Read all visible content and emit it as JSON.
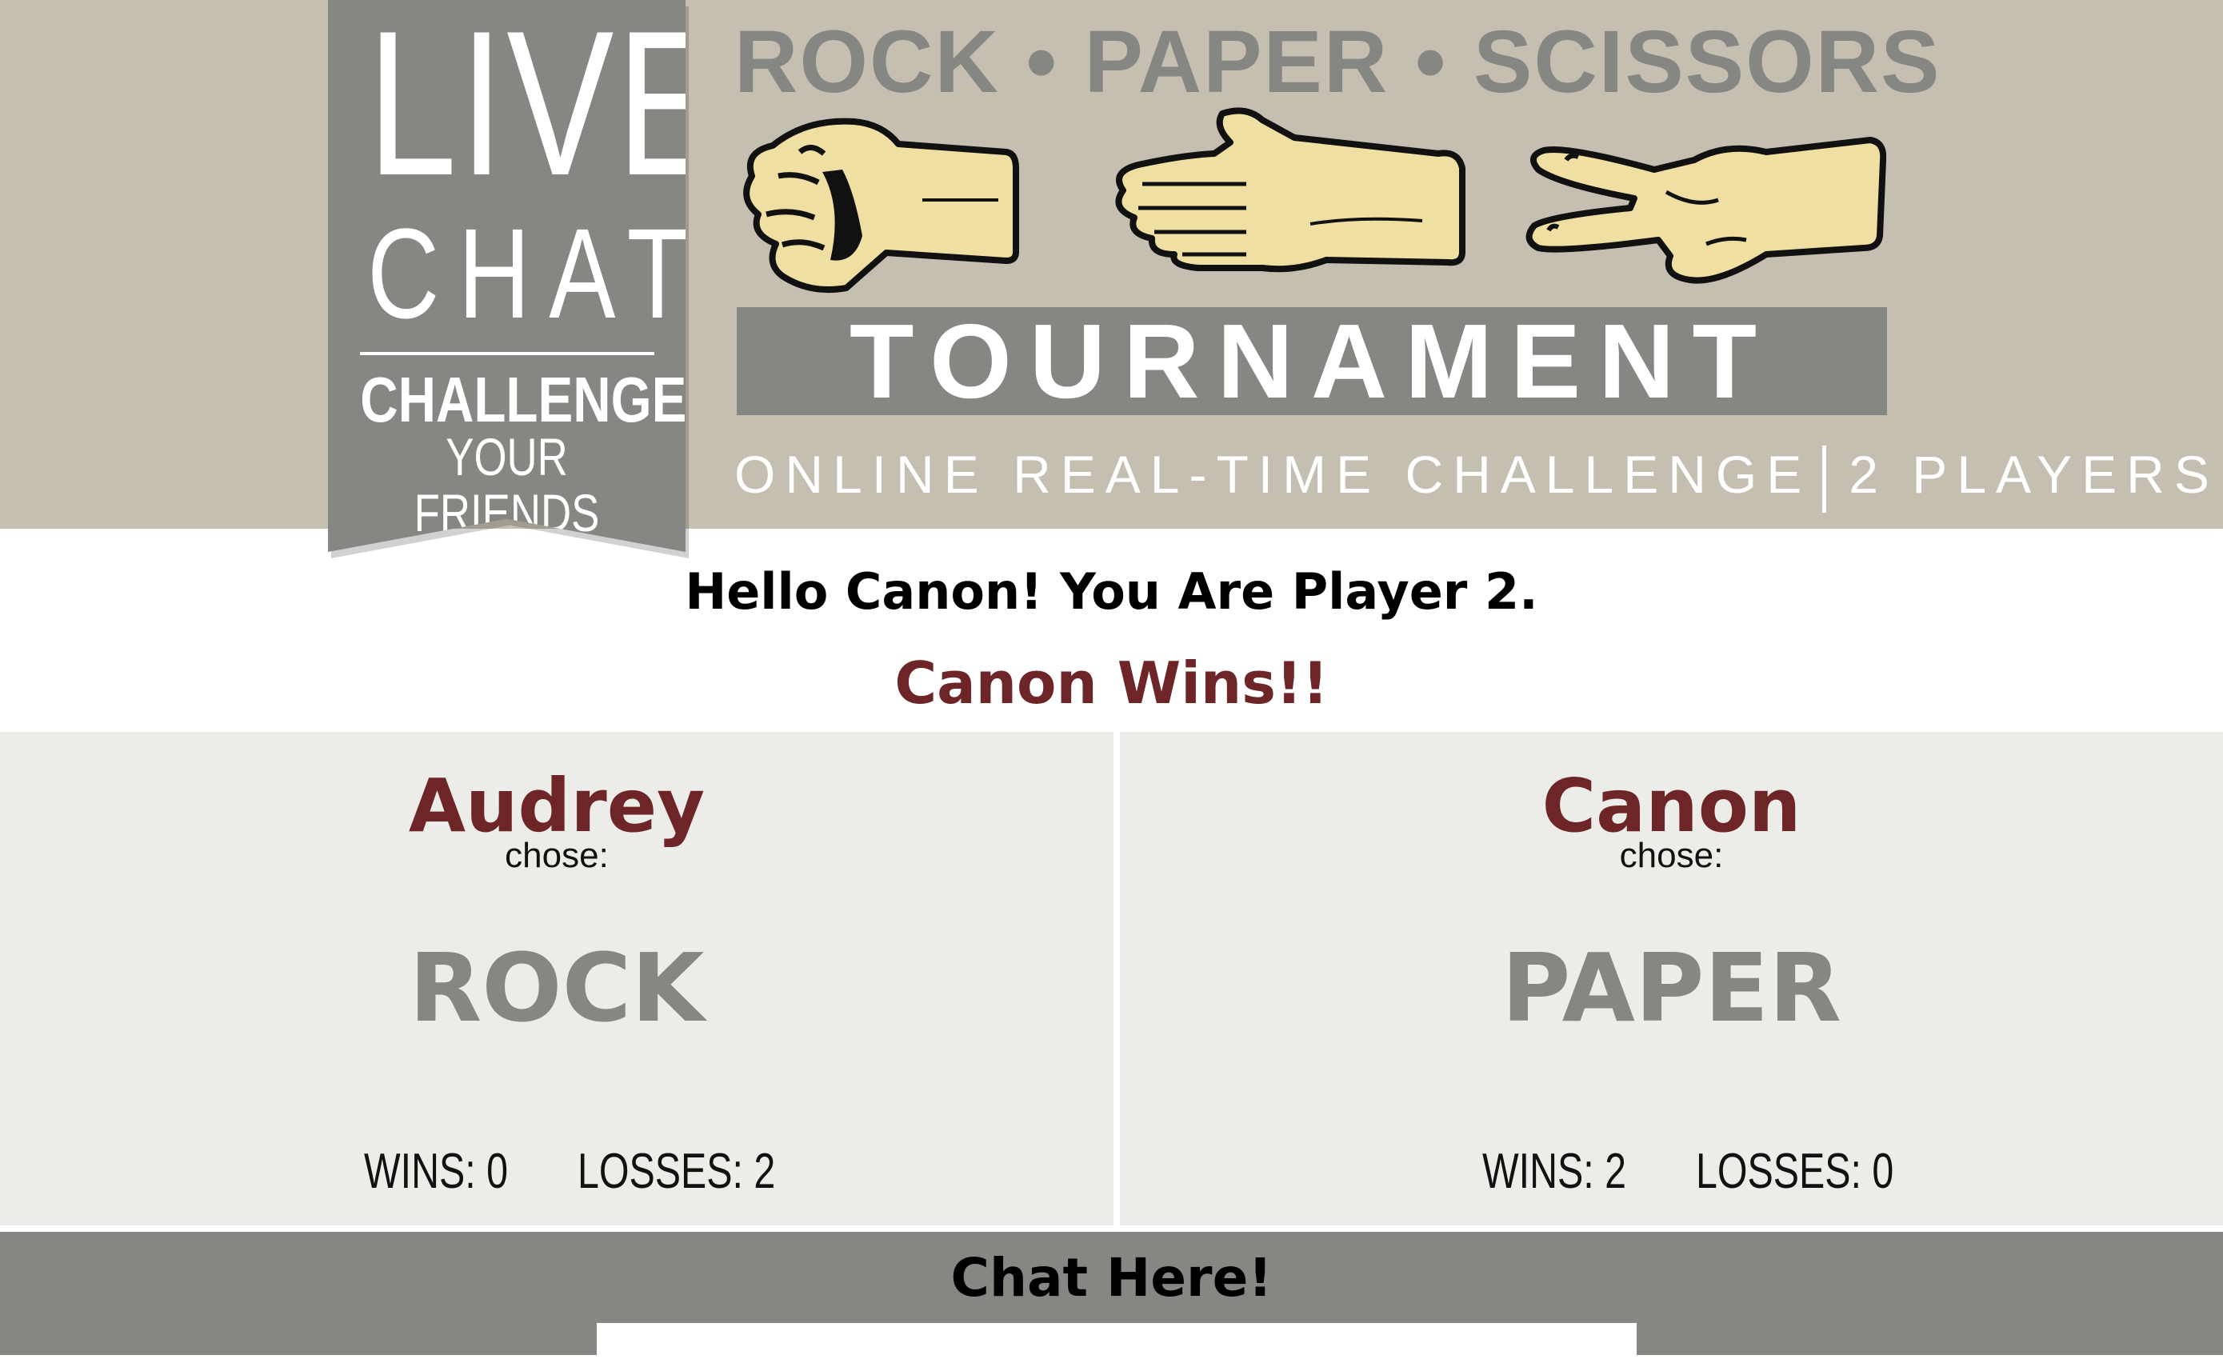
{
  "banner": {
    "ribbon": {
      "live": "LIVE",
      "chat": "CHAT",
      "challenge": "CHALLENGE",
      "friends": "YOUR FRIENDS"
    },
    "title": "ROCK • PAPER • SCISSORS",
    "tournament": "TOURNAMENT",
    "subtitle_left": "ONLINE REAL-TIME CHALLENGE",
    "subtitle_right": "2 PLAYERS",
    "hand_icons": [
      "rock-fist-icon",
      "paper-hand-icon",
      "scissors-hand-icon"
    ]
  },
  "greeting": "Hello Canon! You Are Player 2.",
  "result": "Canon Wins!!",
  "players": [
    {
      "name": "Audrey",
      "chose_label": "chose:",
      "choice": "ROCK",
      "wins": "WINS: 0",
      "losses": "LOSSES: 2"
    },
    {
      "name": "Canon",
      "chose_label": "chose:",
      "choice": "PAPER",
      "wins": "WINS: 2",
      "losses": "LOSSES: 0"
    }
  ],
  "chat": {
    "title": "Chat Here!",
    "input_value": ""
  },
  "colors": {
    "banner_bg": "#c4bfb0",
    "ribbon_gray": "#868683",
    "accent_maroon": "#6e2527",
    "panel_bg": "#ecece8",
    "hand_skin": "#f0dfa2"
  }
}
